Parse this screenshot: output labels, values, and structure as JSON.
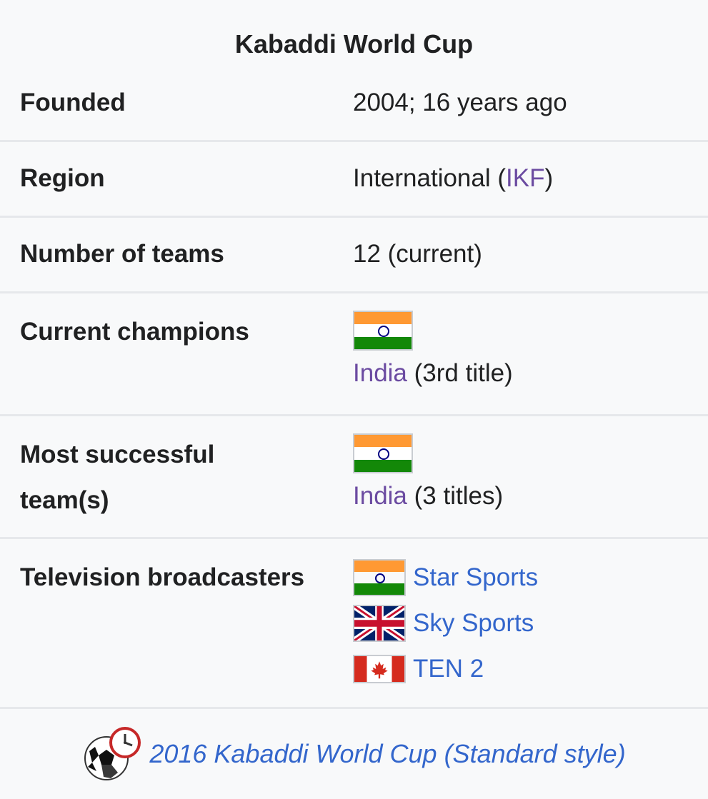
{
  "infobox": {
    "title": "Kabaddi World Cup",
    "founded": {
      "label": "Founded",
      "value": "2004; 16 years ago"
    },
    "region": {
      "label": "Region",
      "value_prefix": "International (",
      "link": "IKF",
      "value_suffix": ")"
    },
    "teams": {
      "label": "Number of teams",
      "value": "12 (current)"
    },
    "champions": {
      "label": "Current champions",
      "flag_icon": "india-flag-icon",
      "link": "India",
      "suffix": " (3rd title)"
    },
    "most_successful": {
      "label_line1": "Most successful",
      "label_line2": "team(s)",
      "flag_icon": "india-flag-icon",
      "link": "India",
      "suffix": " (3 titles)"
    },
    "broadcasters": {
      "label": "Television broadcasters",
      "items": [
        {
          "flag_icon": "india-flag-icon",
          "name": "Star Sports"
        },
        {
          "flag_icon": "uk-flag-icon",
          "name": "Sky Sports"
        },
        {
          "flag_icon": "canada-flag-icon",
          "name": "TEN 2"
        }
      ]
    },
    "footer": {
      "icon": "soccer-ball-clock-icon",
      "link": "2016 Kabaddi World Cup (Standard style)"
    }
  }
}
